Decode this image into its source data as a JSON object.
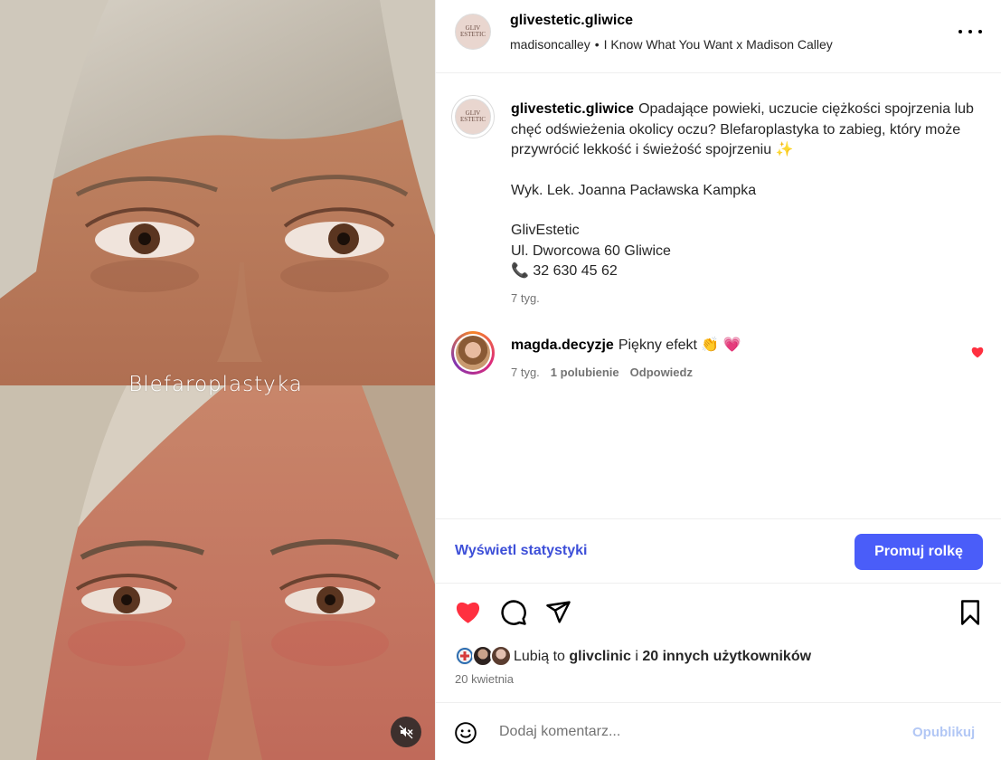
{
  "media": {
    "overlay_text": "Blefaroplastyka"
  },
  "header": {
    "username": "glivestetic.gliwice",
    "avatar_text": "GLIV ESTETIC",
    "audio_author": "madisoncalley",
    "separator": "•",
    "audio_title": "I Know What You Want x Madison Calley"
  },
  "caption": {
    "username": "glivestetic.gliwice",
    "line1": "Opadające powieki, uczucie ciężkości spojrzenia lub chęć odświeżenia okolicy oczu? Blefaroplastyka to zabieg, który może przywrócić lekkość i świeżość spojrzeniu ✨",
    "line2": "Wyk. Lek. Joanna Pacławska Kampka",
    "line3": "GlivEstetic",
    "line4": "Ul. Dworcowa 60 Gliwice",
    "phone_emoji": "📞",
    "phone": "32 630 45 62",
    "time": "7 tyg."
  },
  "comment": {
    "username": "magda.decyzje",
    "text": "Piękny efekt 👏 💗",
    "time": "7 tyg.",
    "likes": "1 polubienie",
    "reply": "Odpowiedz"
  },
  "stats": {
    "view_stats": "Wyświetl statystyki",
    "promote": "Promuj rolkę"
  },
  "likes": {
    "prefix": "Lubią to",
    "user": "glivclinic",
    "connector": "i",
    "others": "20 innych użytkowników"
  },
  "date": "20 kwietnia",
  "comment_box": {
    "placeholder": "Dodaj komentarz...",
    "publish": "Opublikuj"
  },
  "colors": {
    "accent_blue": "#4a5df9",
    "like_red": "#ff3040",
    "link_blue": "#3d4fd8"
  }
}
